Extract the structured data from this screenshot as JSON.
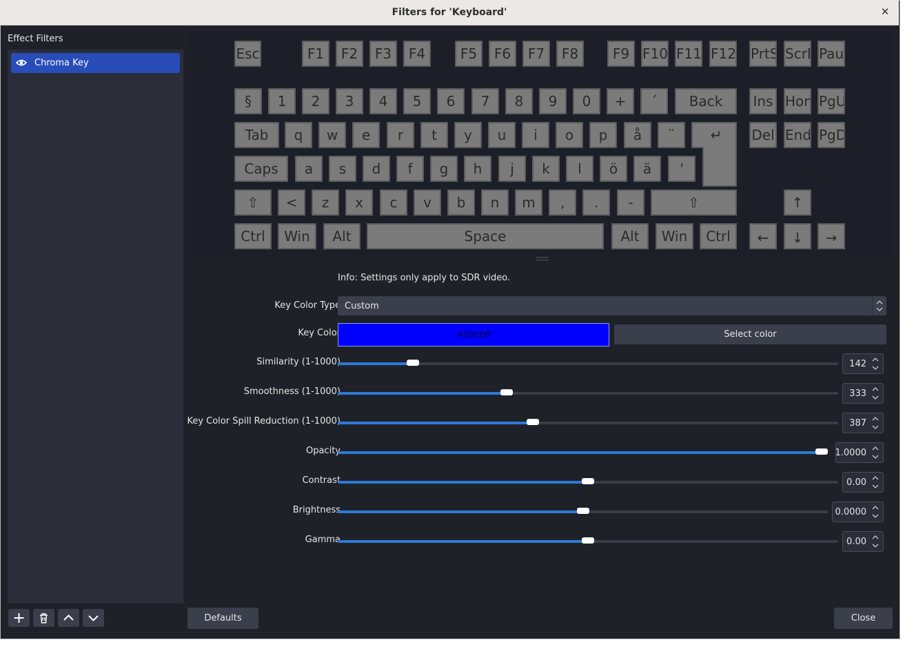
{
  "window": {
    "title": "Filters for 'Keyboard'"
  },
  "sidebar": {
    "header": "Effect Filters",
    "items": [
      {
        "label": "Chroma Key",
        "visible": true
      }
    ],
    "toolbar": [
      "add-icon",
      "trash-icon",
      "move-up-icon",
      "move-down-icon"
    ]
  },
  "keyboard": {
    "fn_row": [
      "Esc",
      "F1",
      "F2",
      "F3",
      "F4",
      "F5",
      "F6",
      "F7",
      "F8",
      "F9",
      "F10",
      "F11",
      "F12",
      "PrtSc",
      "ScrLk",
      "Pause"
    ],
    "num_row": [
      "§",
      "1",
      "2",
      "3",
      "4",
      "5",
      "6",
      "7",
      "8",
      "9",
      "0",
      "+",
      "´",
      "Back",
      "Ins",
      "Home",
      "PgUp"
    ],
    "top_row": [
      "Tab",
      "q",
      "w",
      "e",
      "r",
      "t",
      "y",
      "u",
      "i",
      "o",
      "p",
      "å",
      "¨",
      "↵",
      "Del",
      "End",
      "PgDn"
    ],
    "home_row": [
      "Caps",
      "a",
      "s",
      "d",
      "f",
      "g",
      "h",
      "j",
      "k",
      "l",
      "ö",
      "ä",
      "'"
    ],
    "shift_row": [
      "⇧",
      "<",
      "z",
      "x",
      "c",
      "v",
      "b",
      "n",
      "m",
      ",",
      ".",
      "-",
      "⇧",
      "↑"
    ],
    "bottom_row": [
      "Ctrl",
      "Win",
      "Alt",
      "Space",
      "Alt",
      "Win",
      "Ctrl",
      "←",
      "↓",
      "→"
    ]
  },
  "settings": {
    "info": "Info: Settings only apply to SDR video.",
    "key_color_type": {
      "label": "Key Color Type",
      "value": "Custom"
    },
    "key_color": {
      "label": "Key Color",
      "hex": "#0000ff",
      "button": "Select color"
    },
    "sliders": [
      {
        "label": "Similarity (1-1000)",
        "value": "142",
        "fraction": 0.141
      },
      {
        "label": "Smoothness (1-1000)",
        "value": "333",
        "fraction": 0.333
      },
      {
        "label": "Key Color Spill Reduction (1-1000)",
        "value": "387",
        "fraction": 0.387
      },
      {
        "label": "Opacity",
        "value": "1.0000",
        "fraction": 1.0
      },
      {
        "label": "Contrast",
        "value": "0.00",
        "fraction": 0.5
      },
      {
        "label": "Brightness",
        "value": "0.0000",
        "fraction": 0.5
      },
      {
        "label": "Gamma",
        "value": "0.00",
        "fraction": 0.5
      }
    ]
  },
  "buttons": {
    "defaults": "Defaults",
    "close": "Close"
  },
  "colors": {
    "accent": "#2d7ad8",
    "selection": "#284cb8",
    "background": "#1f2128"
  }
}
